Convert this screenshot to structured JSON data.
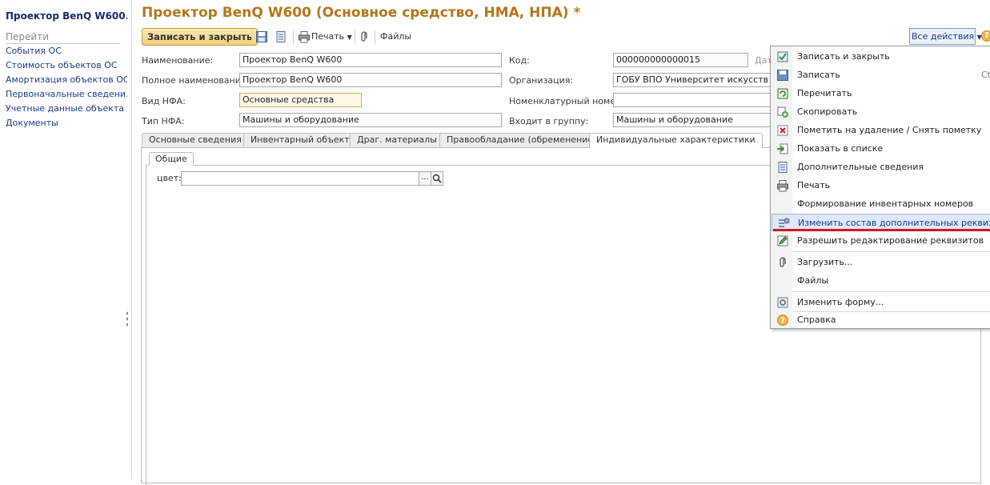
{
  "sidebar": {
    "title": "Проектор BenQ W600...",
    "goto_label": "Перейти",
    "items": [
      {
        "label": "События ОС"
      },
      {
        "label": "Стоимость объектов ОС"
      },
      {
        "label": "Амортизация объектов ОС"
      },
      {
        "label": "Первоначальные сведени..."
      },
      {
        "label": "Учетные данные объекта ..."
      },
      {
        "label": "Документы"
      }
    ]
  },
  "header": {
    "title": "Проектор BenQ W600 (Основное средство, НМА, НПА) *"
  },
  "toolbar": {
    "save_close_label": "Записать и закрыть",
    "print_label": "Печать",
    "files_label": "Файлы",
    "all_actions_label": "Все действия",
    "help_label": "?"
  },
  "form": {
    "name_label": "Наименование:",
    "name_value": "Проектор BenQ W600",
    "fullname_label": "Полное наименование:",
    "fullname_value": "Проектор BenQ W600",
    "vid_label": "Вид НФА:",
    "vid_value": "Основные средства",
    "tip_label": "Тип НФА:",
    "tip_value": "Машины и оборудование",
    "kod_label": "Код:",
    "kod_value": "000000000000015",
    "date_label": "Дат",
    "org_label": "Организация:",
    "org_value": "ГОБУ ВПО Университет искусств (Суб",
    "nomen_label": "Номенклатурный номер:",
    "nomen_value": "",
    "group_label": "Входит в группу:",
    "group_value": "Машины и оборудование"
  },
  "tabs": [
    {
      "label": "Основные сведения"
    },
    {
      "label": "Инвентарный объект"
    },
    {
      "label": "Драг. материалы"
    },
    {
      "label": "Правообладание (обременение)"
    },
    {
      "label": "Индивидуальные характеристики"
    }
  ],
  "subtab": {
    "label": "Общие"
  },
  "color_field": {
    "label": "цвет:",
    "value": "",
    "select_glyph": "..."
  },
  "menu": {
    "items": [
      {
        "label": "Записать и закрыть",
        "shortcut": ""
      },
      {
        "label": "Записать",
        "shortcut": "Ctr"
      },
      {
        "label": "Перечитать",
        "shortcut": ""
      },
      {
        "label": "Скопировать",
        "shortcut": ""
      },
      {
        "label": "Пометить на удаление / Снять пометку",
        "shortcut": ""
      },
      {
        "label": "Показать в списке",
        "shortcut": ""
      },
      {
        "label": "Дополнительные сведения",
        "shortcut": ""
      },
      {
        "label": "Печать",
        "shortcut": ""
      },
      {
        "label": "Формирование инвентарных номеров",
        "shortcut": ""
      },
      {
        "label": "Изменить состав дополнительных реквизитов",
        "shortcut": ""
      },
      {
        "label": "Разрешить редактирование реквизитов",
        "shortcut": ""
      },
      {
        "label": "Загрузить...",
        "shortcut": ""
      },
      {
        "label": "Файлы",
        "shortcut": ""
      },
      {
        "label": "Изменить форму...",
        "shortcut": ""
      },
      {
        "label": "Справка",
        "shortcut": ""
      }
    ]
  },
  "colors": {
    "title": "#b5761b",
    "link": "#1b3b8a",
    "highlight": "#d6161c",
    "accent_button": "#f0cf7a"
  }
}
